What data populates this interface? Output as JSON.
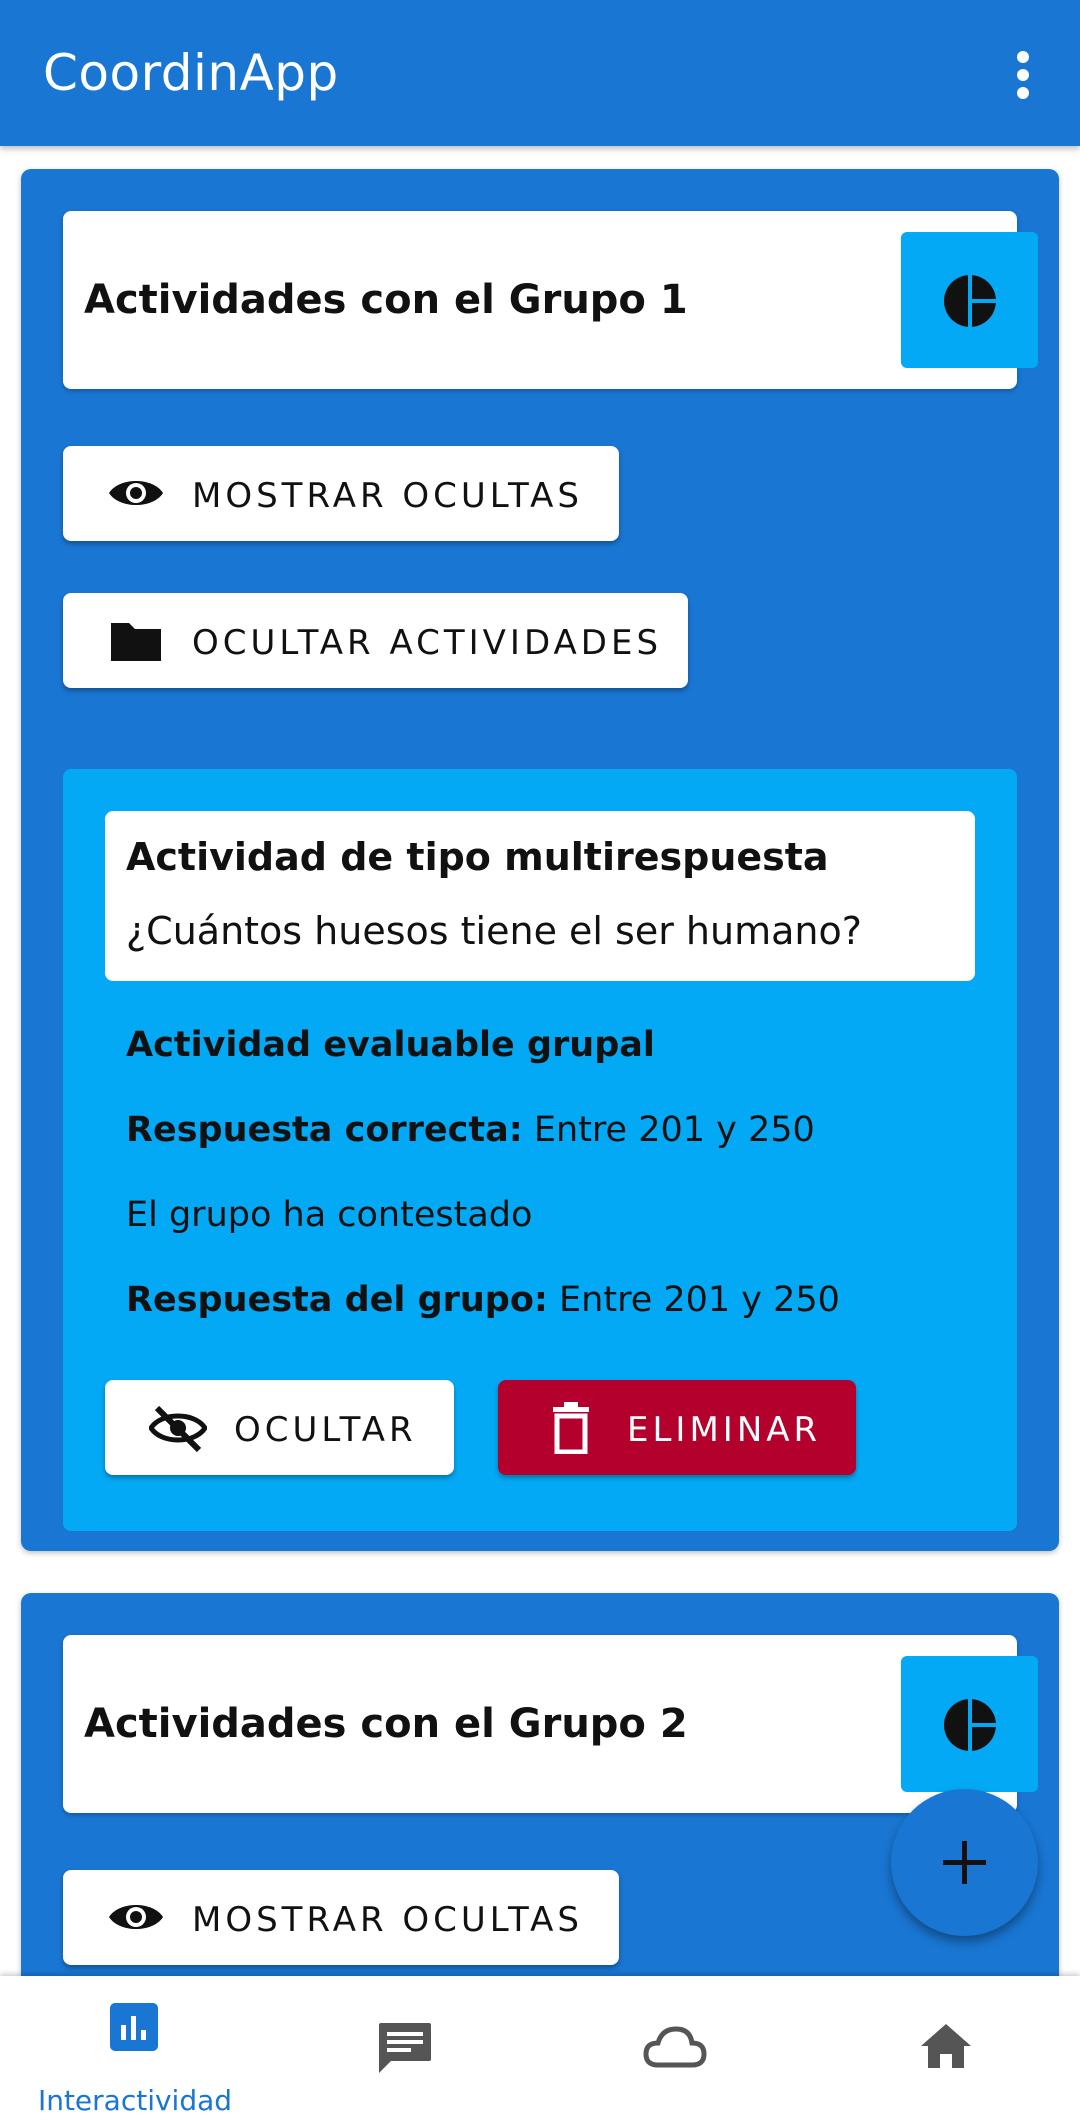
{
  "app": {
    "title": "CoordinApp"
  },
  "groups": [
    {
      "title": "Actividades con el Grupo 1",
      "show_hidden_label": "MOSTRAR OCULTAS",
      "hide_activities_label": "OCULTAR ACTIVIDADES",
      "activity": {
        "type_title": "Actividad de tipo multirespuesta",
        "question": "¿Cuántos huesos tiene el ser humano?",
        "evaluable": "Actividad evaluable grupal",
        "correct_label": "Respuesta correcta:",
        "correct_value": "Entre 201 y 250",
        "status": "El grupo ha contestado",
        "group_answer_label": "Respuesta del grupo:",
        "group_answer_value": "Entre 201 y 250",
        "hide_label": "OCULTAR",
        "delete_label": "ELIMINAR"
      }
    },
    {
      "title": "Actividades con el Grupo 2",
      "show_hidden_label": "MOSTRAR OCULTAS"
    }
  ],
  "bottom_nav": {
    "items": [
      {
        "label": "Interactividad",
        "icon": "bar-chart-icon",
        "active": true
      },
      {
        "label": "",
        "icon": "chat-icon",
        "active": false
      },
      {
        "label": "",
        "icon": "cloud-icon",
        "active": false
      },
      {
        "label": "",
        "icon": "home-icon",
        "active": false
      }
    ]
  },
  "colors": {
    "primary": "#1976d2",
    "accent": "#03a9f4",
    "danger": "#b3002d",
    "nav_inactive": "#555555"
  }
}
